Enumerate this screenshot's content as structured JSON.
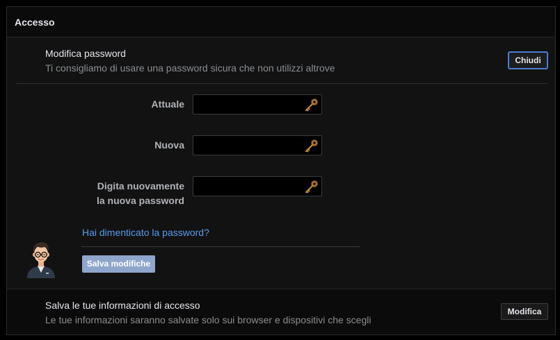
{
  "header": {
    "title": "Accesso"
  },
  "password_section": {
    "title": "Modifica password",
    "subtitle": "Ti consigliamo di usare una password sicura che non utilizzi altrove",
    "close_label": "Chiudi",
    "fields": [
      {
        "label": "Attuale",
        "value": "",
        "icon": "key-icon"
      },
      {
        "label": "Nuova",
        "value": "",
        "icon": "key-icon"
      },
      {
        "label_line1": "Digita nuovamente",
        "label_line2": "la nuova password",
        "value": "",
        "icon": "key-icon"
      }
    ],
    "forgot_link": "Hai dimenticato la password?",
    "save_label": "Salva modifiche"
  },
  "login_info_section": {
    "title": "Salva le tue informazioni di accesso",
    "subtitle": "Le tue informazioni saranno salvate solo sui browser e dispositivi che scegli",
    "edit_label": "Modifica"
  },
  "colors": {
    "link": "#5b9bf0",
    "close_border": "#4b7fd0",
    "save_button_bg": "#8fa6cc"
  }
}
